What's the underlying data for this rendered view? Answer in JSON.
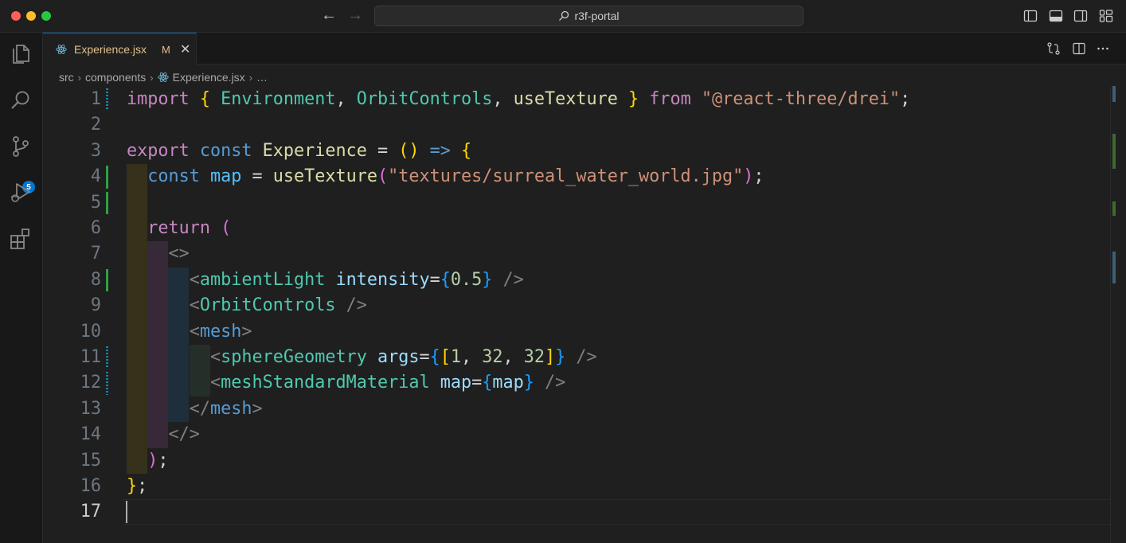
{
  "window": {
    "title": "r3f-portal"
  },
  "activity_bar": {
    "items": [
      {
        "icon": "files-icon",
        "label": "Explorer"
      },
      {
        "icon": "search-icon",
        "label": "Search"
      },
      {
        "icon": "source-control-icon",
        "label": "Source Control",
        "badge": "5"
      },
      {
        "icon": "run-debug-icon",
        "label": "Run and Debug"
      },
      {
        "icon": "extensions-icon",
        "label": "Extensions"
      }
    ]
  },
  "tab": {
    "label": "Experience.jsx",
    "status": "M",
    "close": "✕"
  },
  "breadcrumb": {
    "items": [
      "src",
      "components",
      "Experience.jsx",
      "…"
    ]
  },
  "editor": {
    "active_line": 17,
    "lines": [
      {
        "n": "1",
        "mark": "stripe",
        "text": "import { Environment, OrbitControls, useTexture } from \"@react-three/drei\";"
      },
      {
        "n": "2",
        "mark": "",
        "text": ""
      },
      {
        "n": "3",
        "mark": "",
        "text": "export const Experience = () => {"
      },
      {
        "n": "4",
        "mark": "mod",
        "text": "  const map = useTexture(\"textures/surreal_water_world.jpg\");"
      },
      {
        "n": "5",
        "mark": "mod",
        "text": ""
      },
      {
        "n": "6",
        "mark": "",
        "text": "  return ("
      },
      {
        "n": "7",
        "mark": "",
        "text": "    <>"
      },
      {
        "n": "8",
        "mark": "mod",
        "text": "      <ambientLight intensity={0.5} />"
      },
      {
        "n": "9",
        "mark": "",
        "text": "      <OrbitControls />"
      },
      {
        "n": "10",
        "mark": "",
        "text": "      <mesh>"
      },
      {
        "n": "11",
        "mark": "stripe",
        "text": "        <sphereGeometry args={[1, 32, 32]} />"
      },
      {
        "n": "12",
        "mark": "stripe",
        "text": "        <meshStandardMaterial map={map} />"
      },
      {
        "n": "13",
        "mark": "",
        "text": "      </mesh>"
      },
      {
        "n": "14",
        "mark": "",
        "text": "    </>"
      },
      {
        "n": "15",
        "mark": "",
        "text": "  );"
      },
      {
        "n": "16",
        "mark": "",
        "text": "};"
      },
      {
        "n": "17",
        "mark": "",
        "text": ""
      }
    ]
  },
  "colors": {
    "keyword_control": "#c586c0",
    "keyword_storage": "#569cd6",
    "function": "#dcdcaa",
    "variable": "#9cdcfe",
    "constant": "#4fc1ff",
    "component": "#4ec9b0",
    "string": "#ce9178",
    "number": "#b5cea8",
    "bracket_1": "#ffd700",
    "bracket_2": "#da70d6",
    "bracket_3": "#179fff",
    "modified_tab": "#e2c08d",
    "accent": "#0078d4"
  }
}
